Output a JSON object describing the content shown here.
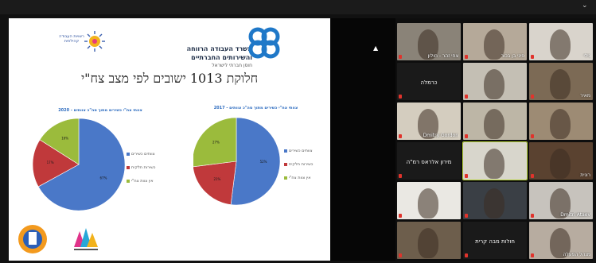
{
  "window": {
    "menu_glyph": "⌄"
  },
  "slide": {
    "title": "חלוקת 1013 ישובים לפי מצב צח\"י",
    "org": {
      "line1": "משרד העבודה הרווחה",
      "line2": "והשירותים החברתיים",
      "line3": "חוסן חברתי לישראל"
    },
    "partner_logo_text": "רשויות העבודה קהילתית"
  },
  "chart_data": [
    {
      "type": "pie",
      "title": "צוותי צח\"י כשירים מתוך סה\"כ צוותים - 2017",
      "categories": [
        "צוותים כשירים",
        "כשירות חלקית",
        "אין צוות צח\"י"
      ],
      "values": [
        52,
        21,
        27
      ],
      "colors": [
        "#4a78c8",
        "#c0393b",
        "#9bbb3c"
      ]
    },
    {
      "type": "pie",
      "title": "צוותי צח\"י כשירים מתוך סה\"כ צוותים - 2020",
      "categories": [
        "צוותים כשירים",
        "כשירות חלקית",
        "אין צוות צח\"י"
      ],
      "values": [
        67,
        17,
        16
      ],
      "colors": [
        "#4a78c8",
        "#c0393b",
        "#9bbb3c"
      ]
    }
  ],
  "gallery": {
    "tiles": [
      {
        "label": "צחי זהר - חולון",
        "bg": "#8a8378"
      },
      {
        "label": "פיני בן בכור",
        "bg": "#b5a999"
      },
      {
        "label": "נילי",
        "bg": "#d9d4cc"
      },
      {
        "label": "כרמלה",
        "bg": "#1a1a1a",
        "text_only": true
      },
      {
        "label": "",
        "bg": "#c4bfb4"
      },
      {
        "label": "מאיר",
        "bg": "#7c6a55"
      },
      {
        "label": "Dmitry Gordon",
        "bg": "#d4cdbf"
      },
      {
        "label": "",
        "bg": "#bdb6a6"
      },
      {
        "label": "",
        "bg": "#9d8b74"
      },
      {
        "label": "מירון אלראס רמ\"ה",
        "bg": "#1a1a1a",
        "text_only": true
      },
      {
        "label": "",
        "bg": "#d8d6cc"
      },
      {
        "label": "רונית",
        "bg": "#5a4230"
      },
      {
        "label": "",
        "bg": "#eae8e3"
      },
      {
        "label": "",
        "bg": "#3a3f45"
      },
      {
        "label": "Dmitri Ataev",
        "bg": "#c7c3bd"
      },
      {
        "label": "",
        "bg": "#6d5e4c"
      },
      {
        "label": "חולות מבה קרית",
        "bg": "#1a1a1a",
        "text_only": true
      },
      {
        "label": "מנהל הפעלה",
        "bg": "#b7aca0"
      }
    ]
  }
}
